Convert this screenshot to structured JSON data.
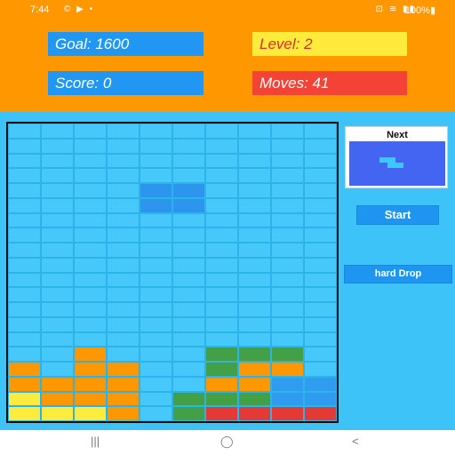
{
  "status_bar": {
    "time": "7:44",
    "left_icons": "© ▶ •",
    "right_icons": "⊡ ≋ ▮▮",
    "battery": "100%▮"
  },
  "stats": {
    "goal": "Goal: 1600",
    "level": "Level: 2",
    "score": "Score: 0",
    "moves": "Moves: 41"
  },
  "colors": {
    "header_bg": "#ff9700",
    "board_bg": "#38c0f6",
    "empty_cell": "#46c8fb",
    "falling_piece": "#2d95ee",
    "O": "#ff9800",
    "Y": "#ffeb3b",
    "G": "#43a047",
    "B": "#2f9cf0",
    "R": "#e53935"
  },
  "board": {
    "columns": 10,
    "rows": 20,
    "falling_piece_cells": [
      [
        4,
        4
      ],
      [
        5,
        4
      ],
      [
        4,
        5
      ],
      [
        5,
        5
      ]
    ],
    "settled_rows": [
      "..O...GGG.",
      "O.OO..GOO.",
      "OOOO..OOBB",
      "YOOO.GGGBB",
      "YYYO.GRRRR"
    ]
  },
  "next": {
    "label": "Next",
    "piece": "Z",
    "piece_cells": [
      [
        0,
        0
      ],
      [
        1,
        0
      ],
      [
        1,
        1
      ],
      [
        2,
        1
      ]
    ]
  },
  "buttons": {
    "start": "Start",
    "hard_drop": "hard Drop"
  },
  "nav_bar": {
    "recents": "|||",
    "home": "◯",
    "back": "<"
  }
}
